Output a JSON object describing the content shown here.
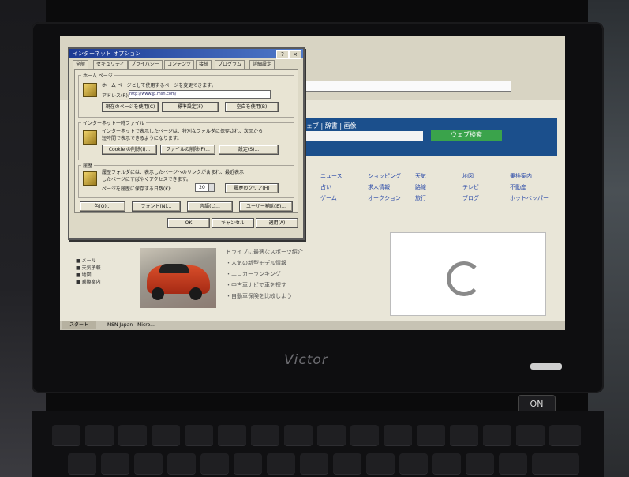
{
  "laptop": {
    "brand": "Victor",
    "power_label": "ON"
  },
  "dialog": {
    "title": "インターネット オプション",
    "tabs": [
      "全般",
      "セキュリティ",
      "プライバシー",
      "コンテンツ",
      "接続",
      "プログラム",
      "詳細設定"
    ],
    "home_group": {
      "label": "ホーム ページ",
      "desc": "ホーム ページとして使用するページを変更できます。",
      "address_label": "アドレス(R):",
      "address_value": "http://www.jp.msn.com/",
      "btn_current": "現在のページを使用(C)",
      "btn_default": "標準設定(F)",
      "btn_blank": "空白を使用(B)"
    },
    "temp_group": {
      "label": "インターネット一時ファイル",
      "desc1": "インターネットで表示したページは、特別なフォルダに保存され、次回から",
      "desc2": "短時間で表示できるようになります。",
      "btn_cookie": "Cookie の削除(I)...",
      "btn_files": "ファイルの削除(F)...",
      "btn_settings": "設定(S)..."
    },
    "history_group": {
      "label": "履歴",
      "desc1": "履歴フォルダには、表示したページへのリンクが含まれ、最近表示",
      "desc2": "したページにすばやくアクセスできます。",
      "days_label": "ページを履歴に保存する日数(K):",
      "days_value": "20",
      "btn_clear": "履歴のクリア(H)"
    },
    "bottom_buttons": [
      "色(O)...",
      "フォント(N)...",
      "言語(L)...",
      "ユーザー補助(E)..."
    ],
    "ok": "OK",
    "cancel": "キャンセル",
    "apply": "適用(A)"
  },
  "browser": {
    "search_band_title": "ウェブ | 辞書 | 画像",
    "search_button": "ウェブ検索",
    "links": [
      "ニュース",
      "ショッピング",
      "天気",
      "地図",
      "乗換案内",
      "占い",
      "求人情報",
      "路線",
      "テレビ",
      "不動産",
      "ゲーム",
      "オークション",
      "旅行",
      "ブログ",
      "ホットペッパー"
    ],
    "news_lines": [
      "ドライブに最適なスポーツ紹介",
      "・人気の新型モデル情報",
      "・エコカーランキング",
      "・中古車ナビで車を探す",
      "・自動車保険を比較しよう"
    ],
    "left_links": [
      "■ メール",
      "■ 天気予報",
      "■ 地図",
      "■ 乗換案内"
    ],
    "taskbar_start": "スタート",
    "taskbar_item": "MSN Japan - Micro..."
  },
  "colors": {
    "search_band": "#1b4f8c",
    "search_button": "#3aa34b",
    "title_bar": "#1c3a93"
  }
}
